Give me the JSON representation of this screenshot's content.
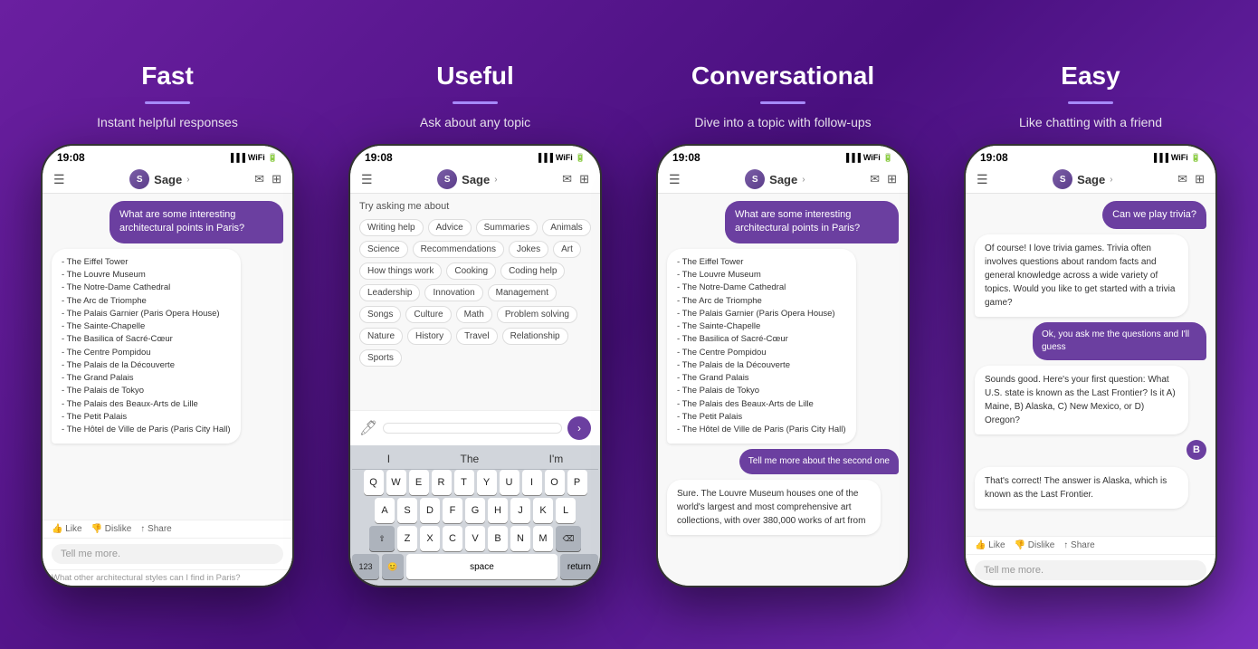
{
  "features": [
    {
      "id": "fast",
      "title": "Fast",
      "subtitle": "Instant helpful responses",
      "phone": {
        "time": "19:08",
        "assistant_name": "Sage",
        "user_message": "What are some interesting architectural points in Paris?",
        "ai_response": "- The Eiffel Tower\n- The Louvre Museum\n- The Notre-Dame Cathedral\n- The Arc de Triomphe\n- The Palais Garnier (Paris Opera House)\n- The Sainte-Chapelle\n- The Basilica of Sacré-Cœur\n- The Centre Pompidou\n- The Palais de la Découverte\n- The Grand Palais\n- The Palais de Tokyo\n- The Palais des Beaux-Arts de Lille\n- The Petit Palais\n- The Hôtel de Ville de Paris (Paris City Hall)",
        "input_placeholder": "Tell me more.",
        "suggestion_text": "What other architectural styles can I find in Paris?"
      }
    },
    {
      "id": "useful",
      "title": "Useful",
      "subtitle": "Ask about any topic",
      "phone": {
        "time": "19:08",
        "assistant_name": "Sage",
        "suggestions_title": "Try asking me about",
        "chips": [
          "Writing help",
          "Advice",
          "Summaries",
          "Animals",
          "Science",
          "Recommendations",
          "Jokes",
          "Art",
          "How things work",
          "Cooking",
          "Coding help",
          "Leadership",
          "Innovation",
          "Management",
          "Songs",
          "Culture",
          "Math",
          "Problem solving",
          "Nature",
          "History",
          "Travel",
          "Relationship",
          "Sports"
        ],
        "keyboard_suggestions": [
          "I",
          "The",
          "I'm"
        ],
        "keyboard_rows": [
          [
            "Q",
            "W",
            "E",
            "R",
            "T",
            "Y",
            "U",
            "I",
            "O",
            "P"
          ],
          [
            "A",
            "S",
            "D",
            "F",
            "G",
            "H",
            "J",
            "K",
            "L"
          ],
          [
            "⇧",
            "Z",
            "X",
            "C",
            "V",
            "B",
            "N",
            "M",
            "⌫"
          ],
          [
            "123",
            "😊",
            "space",
            "return"
          ]
        ]
      }
    },
    {
      "id": "conversational",
      "title": "Conversational",
      "subtitle": "Dive into a topic with follow-ups",
      "phone": {
        "time": "19:08",
        "assistant_name": "Sage",
        "user_message": "What are some interesting architectural points in Paris?",
        "ai_response": "- The Eiffel Tower\n- The Louvre Museum\n- The Notre-Dame Cathedral\n- The Arc de Triomphe\n- The Palais Garnier (Paris Opera House)\n- The Sainte-Chapelle\n- The Basilica of Sacré-Cœur\n- The Centre Pompidou\n- The Palais de la Découverte\n- The Grand Palais\n- The Palais de Tokyo\n- The Palais des Beaux-Arts de Lille\n- The Petit Palais\n- The Hôtel de Ville de Paris (Paris City Hall)",
        "follow_up": "Tell me more about the second one",
        "partial_response": "Sure. The Louvre Museum houses one of the world's largest and most comprehensive art collections, with over 380,000 works of art from"
      }
    },
    {
      "id": "easy",
      "title": "Easy",
      "subtitle": "Like chatting with a friend",
      "phone": {
        "time": "19:08",
        "assistant_name": "Sage",
        "user_message1": "Can we play trivia?",
        "ai_response1": "Of course! I love trivia games. Trivia often involves questions about random facts and general knowledge across a wide variety of topics. Would you like to get started with a trivia game?",
        "user_message2": "Ok, you ask me the questions and I'll guess",
        "ai_response2": "Sounds good. Here's your first question: What U.S. state is known as the Last Frontier? Is it A) Maine, B) Alaska, C) New Mexico, or D) Oregon?",
        "user_message3": "B",
        "ai_response3": "That's correct! The answer is Alaska, which is known as the Last Frontier.",
        "input_placeholder": "Tell me more."
      }
    }
  ]
}
